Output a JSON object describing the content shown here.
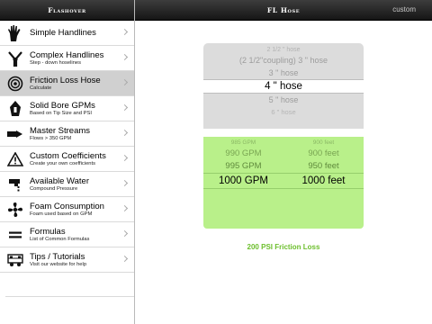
{
  "sidebar": {
    "title": "Flashover",
    "items": [
      {
        "title": "Simple Handlines",
        "subtitle": "",
        "icon": "hand-icon"
      },
      {
        "title": "Complex Handlines",
        "subtitle": "Step - down hoselines",
        "icon": "wye-hoses-icon"
      },
      {
        "title": "Friction Loss Hose",
        "subtitle": "Calculate",
        "icon": "fire-hose-icon",
        "selected": true
      },
      {
        "title": "Solid Bore GPMs",
        "subtitle": "Based on Tip Size and PSI",
        "icon": "nozzle-tip-icon"
      },
      {
        "title": "Master Streams",
        "subtitle": "Flows > 350 GPM",
        "icon": "master-stream-icon"
      },
      {
        "title": "Custom Coefficients",
        "subtitle": "Create your own coefficients",
        "icon": "warning-triangle-icon"
      },
      {
        "title": "Available Water",
        "subtitle": "Compound Pressure",
        "icon": "hydrant-icon"
      },
      {
        "title": "Foam Consumption",
        "subtitle": "Foam used based on GPM",
        "icon": "foam-fan-icon"
      },
      {
        "title": "Formulas",
        "subtitle": "List of Common Formulas",
        "icon": "equals-icon"
      },
      {
        "title": "Tips / Tutorials",
        "subtitle": "Visit our website for help",
        "icon": "fire-truck-icon"
      }
    ]
  },
  "detail": {
    "title": "FL Hose",
    "custom_label": "custom",
    "hose_options": [
      "2 1/2 \" hose",
      "(2 1/2\"coupling) 3 \" hose",
      "3 \" hose",
      "4 \" hose",
      "5 \" hose",
      "6 \" hose"
    ],
    "hose_selected": "4 \" hose",
    "gpm_options": [
      "985 GPM",
      "990 GPM",
      "995 GPM",
      "1000 GPM"
    ],
    "feet_options": [
      "900 feet",
      "900 feet",
      "950 feet",
      "1000 feet"
    ],
    "gpm_selected": "1000 GPM",
    "feet_selected": "1000 feet",
    "result": "200 PSI Friction Loss"
  },
  "colors": {
    "accent_green": "#6cbf2c",
    "picker_green": "#b9f08a",
    "picker_gray": "#dcdcdc"
  }
}
